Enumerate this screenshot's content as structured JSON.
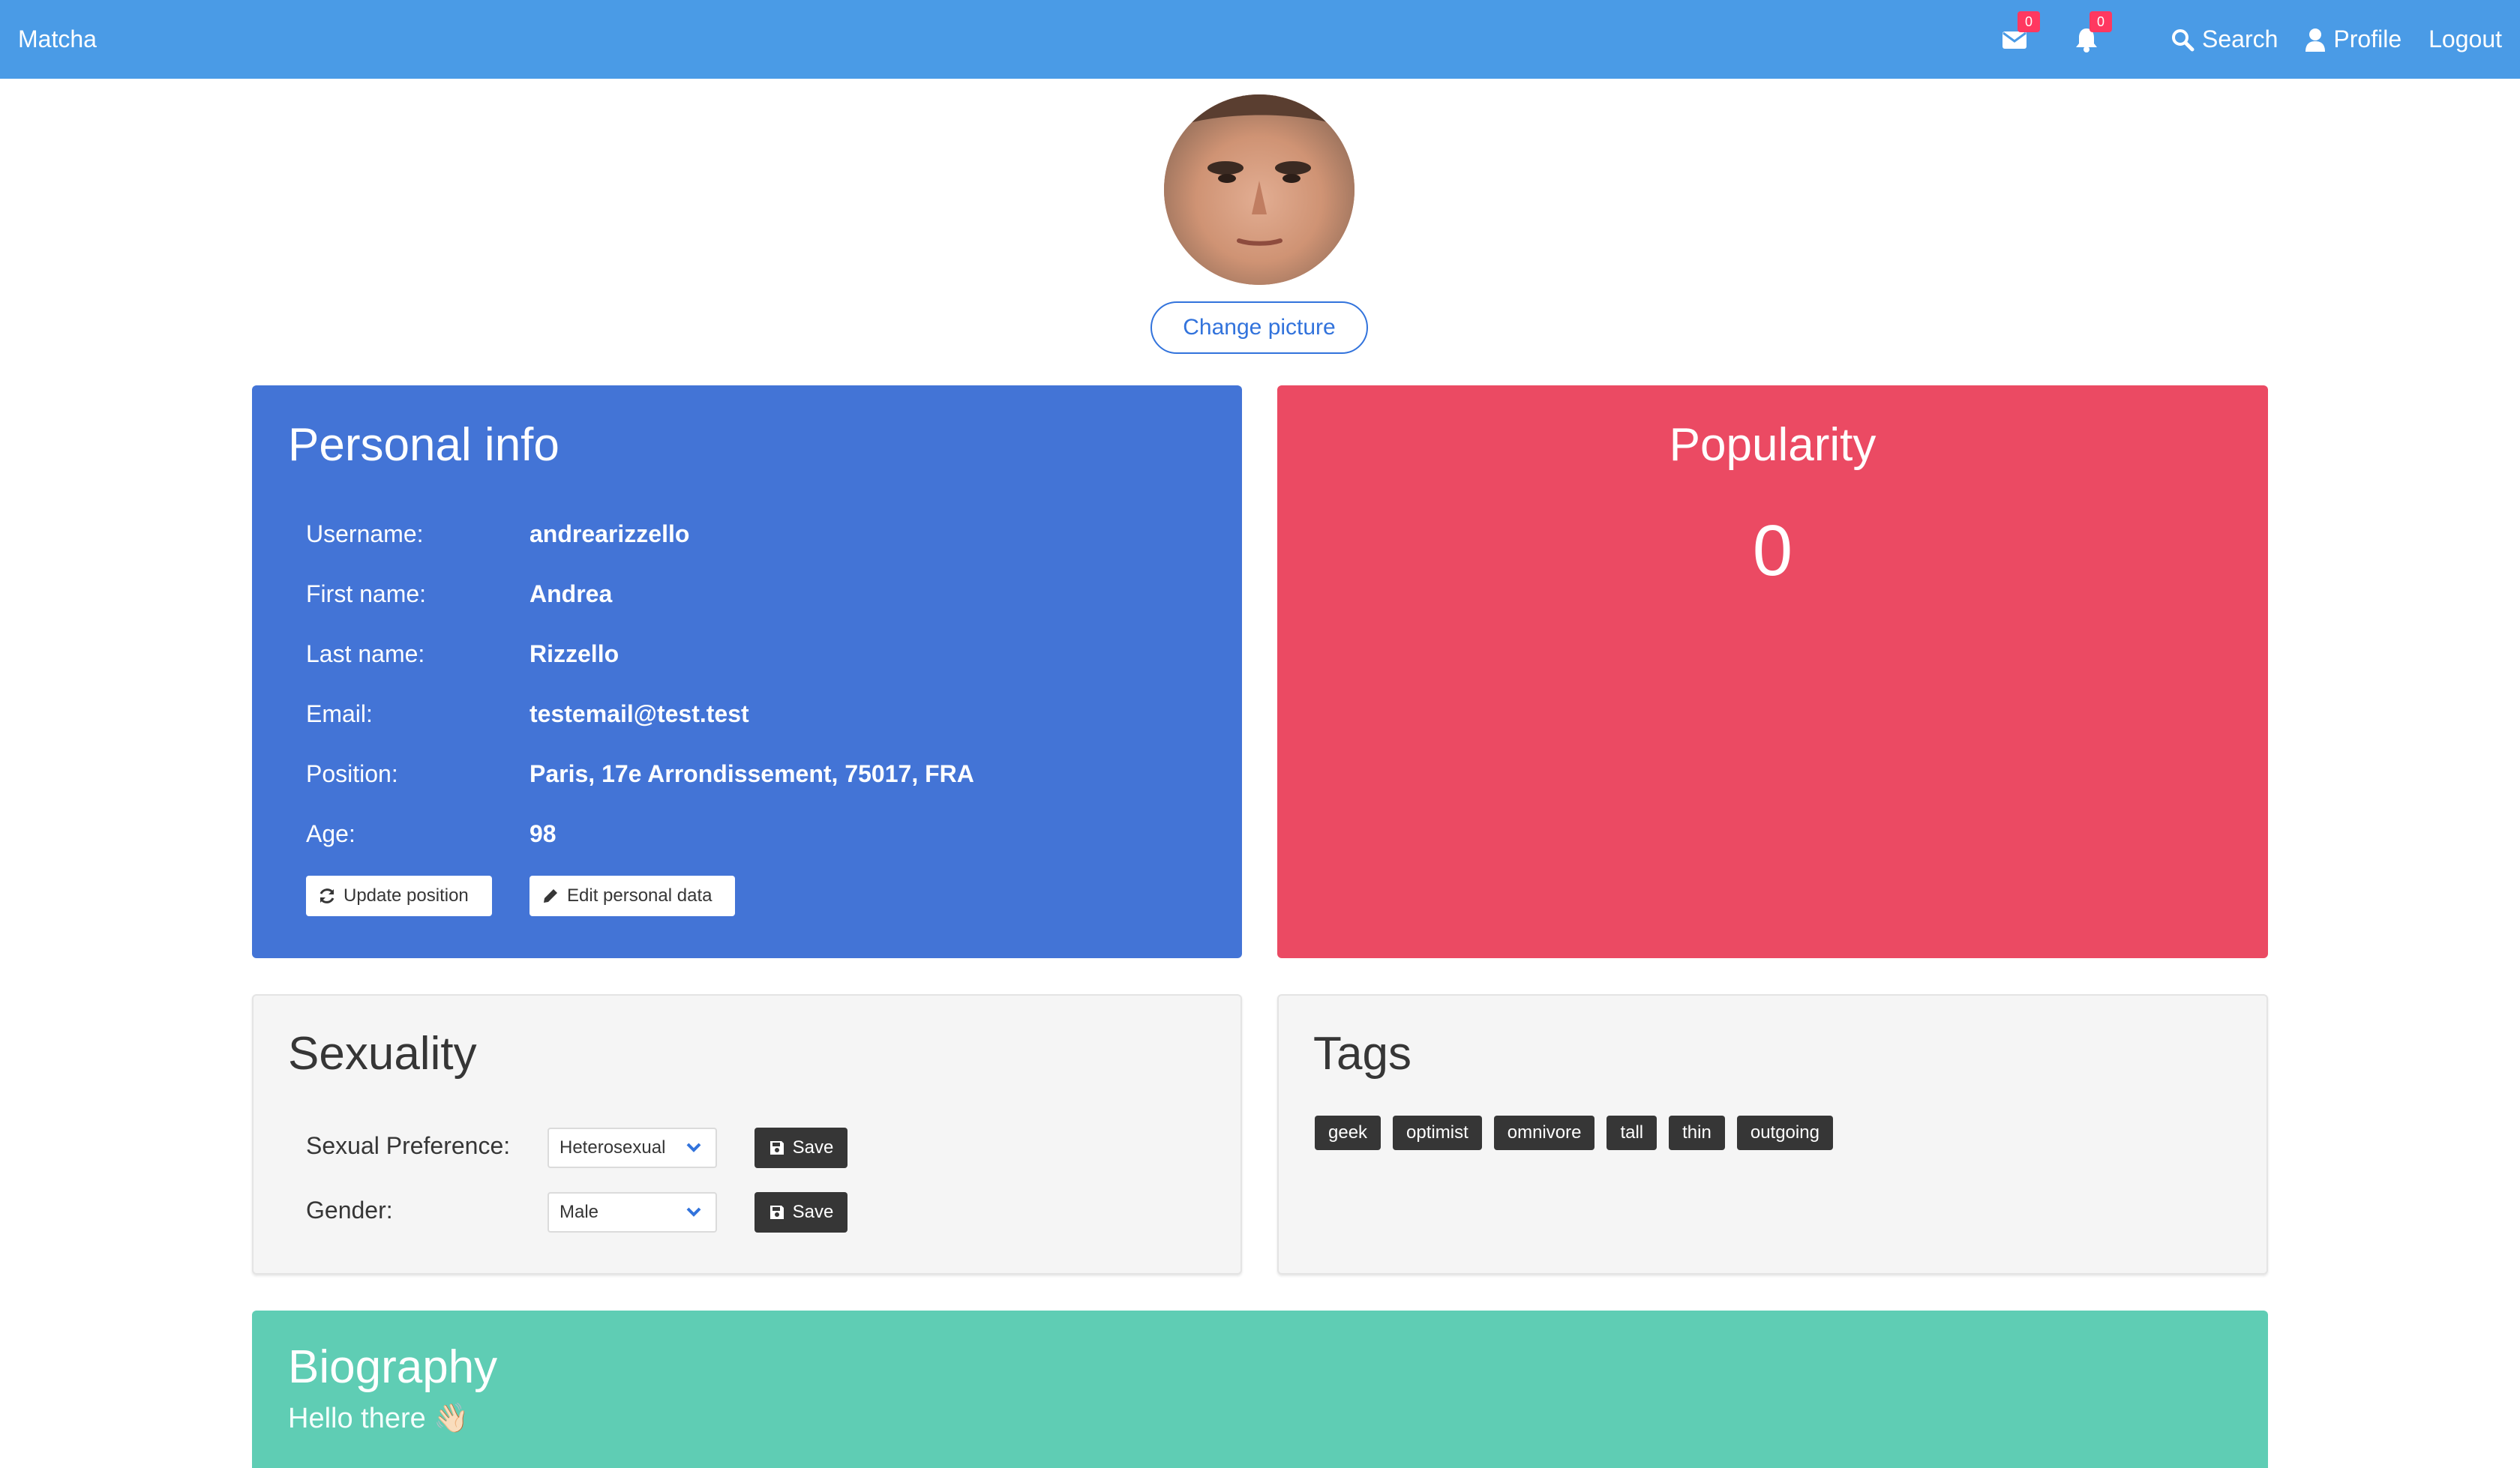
{
  "navbar": {
    "brand": "Matcha",
    "messages_badge": "0",
    "notifications_badge": "0",
    "search_label": "Search",
    "profile_label": "Profile",
    "logout_label": "Logout"
  },
  "profile": {
    "change_picture_label": "Change picture"
  },
  "personal_info": {
    "title": "Personal info",
    "rows": [
      {
        "label": "Username:",
        "value": "andrearizzello"
      },
      {
        "label": "First name:",
        "value": "Andrea"
      },
      {
        "label": "Last name:",
        "value": "Rizzello"
      },
      {
        "label": "Email:",
        "value": "testemail@test.test"
      },
      {
        "label": "Position:",
        "value": "Paris, 17e Arrondissement, 75017, FRA"
      },
      {
        "label": "Age:",
        "value": "98"
      }
    ],
    "update_position_label": "Update position",
    "edit_data_label": "Edit personal data"
  },
  "popularity": {
    "title": "Popularity",
    "value": "0"
  },
  "sexuality": {
    "title": "Sexuality",
    "preference_label": "Sexual Preference:",
    "preference_value": "Heterosexual",
    "gender_label": "Gender:",
    "gender_value": "Male",
    "save_label": "Save"
  },
  "tags": {
    "title": "Tags",
    "items": [
      "geek",
      "optimist",
      "omnivore",
      "tall",
      "thin",
      "outgoing"
    ]
  },
  "biography": {
    "title": "Biography",
    "text": "Hello there 👋🏻"
  },
  "colors": {
    "navbar": "#4a9be6",
    "personal_info": "#4374d6",
    "popularity": "#eb4a63",
    "biography": "#5fcdb4"
  }
}
